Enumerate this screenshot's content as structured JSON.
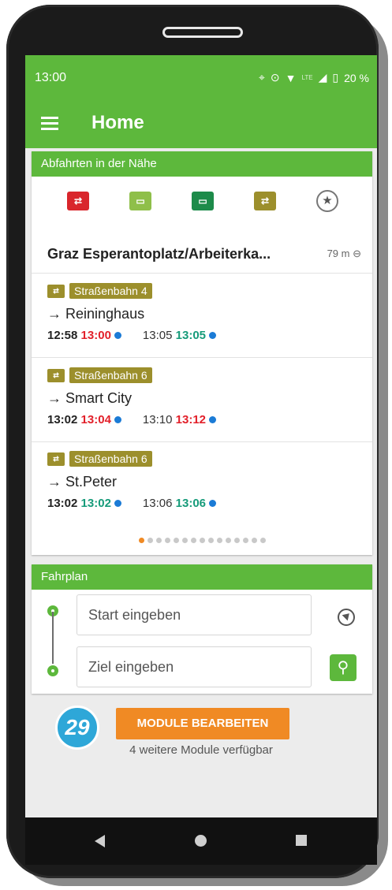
{
  "status": {
    "time": "13:00",
    "battery": "20 %",
    "network": "LTE"
  },
  "appbar": {
    "title": "Home"
  },
  "nearby": {
    "header": "Abfahrten in der Nähe",
    "modes": [
      {
        "name": "train-mode-icon",
        "color": "#d9262c"
      },
      {
        "name": "bus-mode-icon",
        "color": "#8fbf4a"
      },
      {
        "name": "regional-bus-mode-icon",
        "color": "#1d8b4a"
      },
      {
        "name": "tram-mode-icon",
        "color": "#9c8f2c"
      },
      {
        "name": "favorites-star-icon",
        "color": "#777777"
      }
    ],
    "stop": {
      "name": "Graz Esperantoplatz/Arbeiterka...",
      "distance": "79 m"
    },
    "departures": [
      {
        "line": "Straßenbahn 4",
        "dest": "→ Reininghaus",
        "t1_sched": "12:58",
        "t1_real": "13:00",
        "t2_sched": "13:05",
        "t2_real": "13:05"
      },
      {
        "line": "Straßenbahn 6",
        "dest": "→ Smart City",
        "t1_sched": "13:02",
        "t1_real": "13:04",
        "t2_sched": "13:10",
        "t2_real": "13:12"
      },
      {
        "line": "Straßenbahn 6",
        "dest": "→ St.Peter",
        "t1_sched": "13:02",
        "t1_real": "13:02",
        "t2_sched": "13:06",
        "t2_real": "13:06"
      }
    ],
    "page_index": 1,
    "page_count": 15
  },
  "planner": {
    "header": "Fahrplan",
    "start_placeholder": "Start eingeben",
    "dest_placeholder": "Ziel eingeben"
  },
  "module": {
    "button": "MODULE BEARBEITEN",
    "note": "4 weitere Module verfügbar"
  },
  "annotation": {
    "number": "29"
  },
  "colors": {
    "brand_green": "#5db83c",
    "orange": "#f08a24",
    "delay_red": "#e2202a",
    "ontime_green": "#169b7a",
    "tram_olive": "#9c8f2c"
  }
}
